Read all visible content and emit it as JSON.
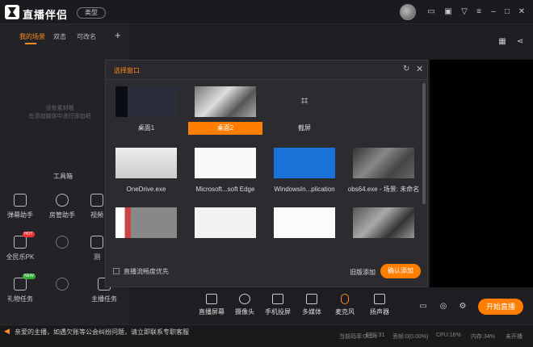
{
  "app": {
    "title": "直播伴侣",
    "type_button": "类型"
  },
  "left_tabs": [
    "我的场景",
    "双击",
    "可改名"
  ],
  "empty_hint": [
    "没有素材哦",
    "在添加媒体中进行添加吧"
  ],
  "toolbox": {
    "title": "工具箱",
    "tools": [
      "弹幕助手",
      "房管助手",
      "视频",
      "全民乐PK",
      "",
      "测",
      "礼物任务",
      "",
      "主播任务"
    ]
  },
  "dialog": {
    "title": "选择窗口",
    "items": [
      "桌面1",
      "桌面2",
      "截屏",
      "OneDrive.exe",
      "Microsoft...soft Edge",
      "WindowsIn...plication",
      "obs64.exe - 场景: 未命名",
      "",
      "",
      ""
    ],
    "checkbox_label": "直播流畅度优先",
    "clear_label": "旧版添加",
    "confirm_label": "确认添加"
  },
  "bottom_tools": [
    "直播屏幕",
    "摄像头",
    "手机投屏",
    "多媒体",
    "麦克风",
    "扬声器"
  ],
  "start_button": "开始直播",
  "status": {
    "message": "亲爱的主播，如遇欠账等公会纠纷问题，请立即联系专职客服",
    "message2": "",
    "stats": [
      "当前码率:0kb/s",
      "FPS:31",
      "丢帧:0(0.00%)",
      "CPU:16%",
      "内存:34%",
      "未开播"
    ]
  }
}
